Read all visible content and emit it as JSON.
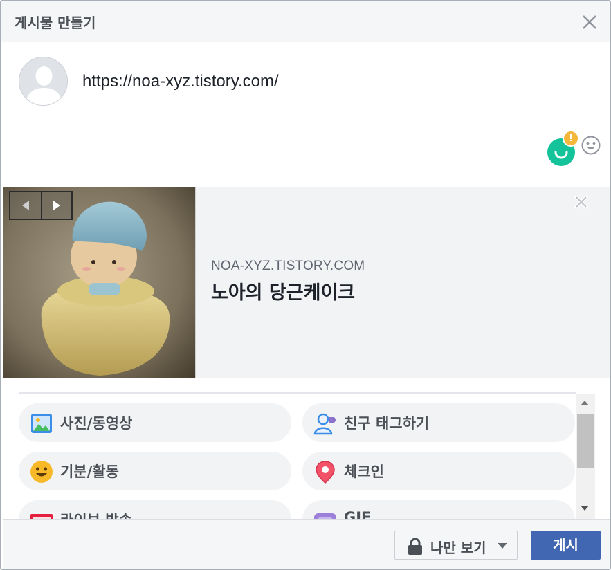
{
  "dialog": {
    "title": "게시물 만들기"
  },
  "composer": {
    "text": "https://noa-xyz.tistory.com/",
    "grammarly_badge": "!"
  },
  "link_preview": {
    "domain": "NOA-XYZ.TISTORY.COM",
    "title": "노아의 당근케이크"
  },
  "options": [
    {
      "label": "사진/동영상",
      "icon": "photo-video-icon"
    },
    {
      "label": "친구 태그하기",
      "icon": "tag-friends-icon"
    },
    {
      "label": "기분/활동",
      "icon": "feeling-icon"
    },
    {
      "label": "체크인",
      "icon": "check-in-icon"
    },
    {
      "label": "라이브 방송",
      "icon": "live-video-icon"
    },
    {
      "label": "GIF",
      "icon": "gif-icon"
    }
  ],
  "footer": {
    "privacy_label": "나만 보기",
    "post_label": "게시"
  },
  "colors": {
    "primary": "#4267b2",
    "grammarly": "#15c39a",
    "grammarly_badge": "#f4b73a",
    "live_badge": "#e41e3f",
    "check_in_pin": "#f35369"
  }
}
